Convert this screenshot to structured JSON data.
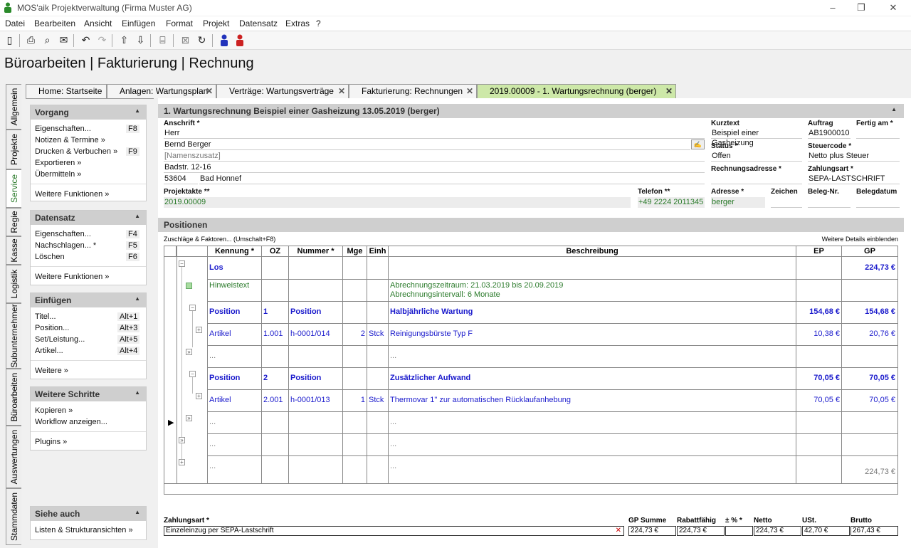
{
  "window": {
    "title": "MOS'aik Projektverwaltung (Firma Muster AG)",
    "min": "–",
    "restore": "❐",
    "close": "✕"
  },
  "menu": [
    "Datei",
    "Bearbeiten",
    "Ansicht",
    "Einfügen",
    "Format",
    "Projekt",
    "Datensatz",
    "Extras",
    "?"
  ],
  "page_title": "Büroarbeiten | Fakturierung | Rechnung",
  "vtabs": [
    "Allgemein",
    "Projekte",
    "Service",
    "Regie",
    "Kasse",
    "Logistik",
    "Subunternehmer",
    "Büroarbeiten",
    "Auswertungen",
    "Stammdaten"
  ],
  "tabs": [
    "Home: Startseite",
    "Anlagen: Wartungsplan",
    "Verträge: Wartungsverträge",
    "Fakturierung: Rechnungen",
    "2019.00009 - 1. Wartungsrechnung (berger)"
  ],
  "sidebar": {
    "vorgang": {
      "title": "Vorgang",
      "items": [
        "Eigenschaften...",
        "Notizen & Termine »",
        "Drucken & Verbuchen »",
        "Exportieren »",
        "Übermitteln »"
      ],
      "keys": [
        "F8",
        "",
        "F9",
        "",
        ""
      ],
      "more": "Weitere Funktionen »"
    },
    "datensatz": {
      "title": "Datensatz",
      "items": [
        "Eigenschaften...",
        "Nachschlagen... *",
        "Löschen"
      ],
      "keys": [
        "F4",
        "F5",
        "F6"
      ],
      "more": "Weitere Funktionen »"
    },
    "einfuegen": {
      "title": "Einfügen",
      "items": [
        "Titel...",
        "Position...",
        "Set/Leistung...",
        "Artikel..."
      ],
      "keys": [
        "Alt+1",
        "Alt+3",
        "Alt+5",
        "Alt+4"
      ],
      "more": "Weitere »"
    },
    "schritte": {
      "title": "Weitere Schritte",
      "items": [
        "Kopieren »",
        "Workflow anzeigen..."
      ],
      "more": "Plugins »"
    },
    "siehe": {
      "title": "Siehe auch",
      "items": [
        "Listen & Strukturansichten »"
      ]
    }
  },
  "header": {
    "title": "1. Wartungsrechnung Beispiel einer Gasheizung 13.05.2019 (berger)",
    "anschrift_label": "Anschrift *",
    "anrede": "Herr",
    "name": "Bernd Berger",
    "zusatz_placeholder": "[Namenszusatz]",
    "strasse": "Badstr. 12-16",
    "plz": "53604",
    "ort": "Bad Honnef",
    "projektakte_label": "Projektakte **",
    "projektakte": "2019.00009",
    "telefon_label": "Telefon **",
    "telefon": "+49 2224 2011345",
    "kurztext_label": "Kurztext",
    "kurztext": "Beispiel einer Gasheizung",
    "auftrag_label": "Auftrag",
    "auftrag": "AB1900010",
    "fertig_label": "Fertig am *",
    "status_label": "Status *",
    "status": "Offen",
    "steuercode_label": "Steuercode *",
    "steuercode": "Netto plus Steuer",
    "rechnungsadresse_label": "Rechnungsadresse *",
    "zahlungsart_label": "Zahlungsart *",
    "zahlungsart": "SEPA-LASTSCHRIFT",
    "adresse_label": "Adresse *",
    "adresse": "berger",
    "zeichen_label": "Zeichen",
    "belegnr_label": "Beleg-Nr.",
    "belegdatum_label": "Belegdatum"
  },
  "positionen": {
    "title": "Positionen",
    "zuschlaege": "Zuschläge & Faktoren... (Umschalt+F8)",
    "details": "Weitere Details einblenden",
    "columns": [
      "Kennung *",
      "OZ",
      "Nummer *",
      "Mge",
      "Einh",
      "Beschreibung",
      "EP",
      "GP"
    ],
    "rows": [
      {
        "kennung": "Los",
        "oz": "",
        "nummer": "",
        "mge": "",
        "einh": "",
        "beschreibung": "",
        "beschreibung2": "",
        "ep": "",
        "gp": "224,73 €",
        "style": "bb"
      },
      {
        "kennung": "Hinweistext",
        "oz": "",
        "nummer": "",
        "mge": "",
        "einh": "",
        "beschreibung": "Abrechnungszeitraum: 21.03.2019 bis 20.09.2019",
        "beschreibung2": "Abrechnungsintervall: 6 Monate",
        "ep": "",
        "gp": "",
        "style": "grn"
      },
      {
        "kennung": "Position",
        "oz": "1",
        "nummer": "Position",
        "mge": "",
        "einh": "",
        "beschreibung": "Halbjährliche Wartung",
        "beschreibung2": "",
        "ep": "154,68 €",
        "gp": "154,68 €",
        "style": "bb"
      },
      {
        "kennung": "Artikel",
        "oz": "1.001",
        "nummer": "h-0001/014",
        "mge": "2",
        "einh": "Stck",
        "beschreibung": "Reinigungsbürste Typ F",
        "beschreibung2": "",
        "ep": "10,38 €",
        "gp": "20,76 €",
        "style": "blue"
      },
      {
        "kennung": "...",
        "oz": "",
        "nummer": "",
        "mge": "",
        "einh": "",
        "beschreibung": "...",
        "beschreibung2": "",
        "ep": "",
        "gp": "",
        "style": "gry"
      },
      {
        "kennung": "Position",
        "oz": "2",
        "nummer": "Position",
        "mge": "",
        "einh": "",
        "beschreibung": "Zusätzlicher Aufwand",
        "beschreibung2": "",
        "ep": "70,05 €",
        "gp": "70,05 €",
        "style": "bb"
      },
      {
        "kennung": "Artikel",
        "oz": "2.001",
        "nummer": "h-0001/013",
        "mge": "1",
        "einh": "Stck",
        "beschreibung": "Thermovar 1\" zur automatischen Rücklaufanhebung",
        "beschreibung2": "",
        "ep": "70,05 €",
        "gp": "70,05 €",
        "style": "blue"
      },
      {
        "kennung": "...",
        "oz": "",
        "nummer": "",
        "mge": "",
        "einh": "",
        "beschreibung": "...",
        "beschreibung2": "",
        "ep": "",
        "gp": "",
        "style": "gry"
      },
      {
        "kennung": "...",
        "oz": "",
        "nummer": "",
        "mge": "",
        "einh": "",
        "beschreibung": "...",
        "beschreibung2": "",
        "ep": "",
        "gp": "",
        "style": "gry"
      },
      {
        "kennung": "...",
        "oz": "",
        "nummer": "",
        "mge": "",
        "einh": "",
        "beschreibung": "...",
        "beschreibung2": "",
        "ep": "",
        "gp": "224,73 €",
        "style": "gry"
      }
    ]
  },
  "footer": {
    "zahlungsart_label": "Zahlungsart *",
    "zahlungsart": "Einzeleinzug per SEPA-Lastschrift",
    "gp_summe_label": "GP Summe",
    "gp_summe": "224,73 €",
    "rabattfaehig_label": "Rabattfähig",
    "rabattfaehig": "224,73 €",
    "prozent_label": "± % *",
    "prozent": "",
    "netto_label": "Netto",
    "netto": "224,73 €",
    "ust_label": "USt.",
    "ust": "42,70 €",
    "brutto_label": "Brutto",
    "brutto": "267,43 €"
  },
  "colors": {
    "accent_green": "#2a7a2a",
    "blue_text": "#1a1acc",
    "active_tab": "#cde8a8"
  }
}
